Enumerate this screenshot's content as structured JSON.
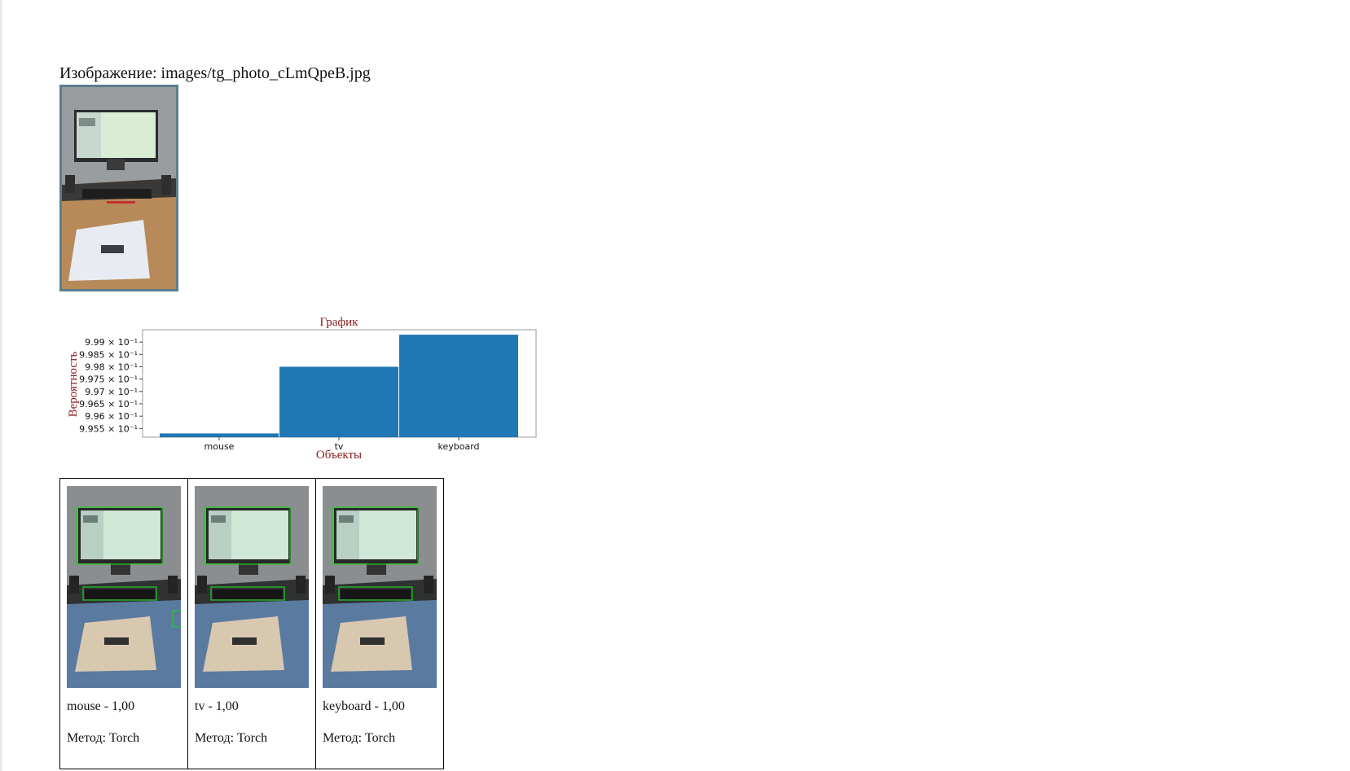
{
  "image_caption": "Изображение: images/tg_photo_cLmQpeB.jpg",
  "colors": {
    "bar": "#1f77b4",
    "chart_text": "#8b1a1a",
    "photo_border": "#5b7e8c",
    "detection_box": "#22cc22"
  },
  "chart_data": {
    "type": "bar",
    "title": "График",
    "xlabel": "Объекты",
    "ylabel": "Вероятность",
    "categories": [
      "mouse",
      "tv",
      "keyboard"
    ],
    "values": [
      0.9953,
      0.998,
      0.9993
    ],
    "yscale": "log",
    "ylim": [
      0.99515,
      0.9995
    ],
    "yticks": [
      0.9955,
      0.996,
      0.9965,
      0.997,
      0.9975,
      0.998,
      0.9985,
      0.999
    ],
    "ytick_labels": [
      "9.955 × 10⁻¹",
      "9.96 × 10⁻¹",
      "9.965 × 10⁻¹",
      "9.97 × 10⁻¹",
      "9.975 × 10⁻¹",
      "9.98 × 10⁻¹",
      "9.985 × 10⁻¹",
      "9.99 × 10⁻¹"
    ],
    "grid": false,
    "legend": "none"
  },
  "results": [
    {
      "label": "mouse - 1,00",
      "method": "Метод: Torch",
      "boxes": [
        "tv",
        "keyboard",
        "mouse"
      ]
    },
    {
      "label": "tv - 1,00",
      "method": "Метод: Torch",
      "boxes": [
        "tv",
        "keyboard"
      ]
    },
    {
      "label": "keyboard - 1,00",
      "method": "Метод: Torch",
      "boxes": [
        "tv",
        "keyboard"
      ]
    }
  ]
}
